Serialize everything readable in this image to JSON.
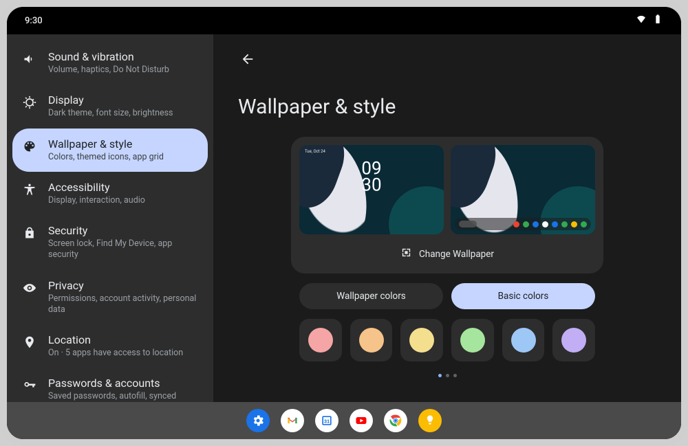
{
  "status": {
    "time": "9:30"
  },
  "sidebar": {
    "items": [
      {
        "title": "Sound & vibration",
        "sub": "Volume, haptics, Do Not Disturb"
      },
      {
        "title": "Display",
        "sub": "Dark theme, font size, brightness"
      },
      {
        "title": "Wallpaper & style",
        "sub": "Colors, themed icons, app grid",
        "selected": true
      },
      {
        "title": "Accessibility",
        "sub": "Display, interaction, audio"
      },
      {
        "title": "Security",
        "sub": "Screen lock, Find My Device, app security"
      },
      {
        "title": "Privacy",
        "sub": "Permissions, account activity, personal data"
      },
      {
        "title": "Location",
        "sub": "On · 5 apps have access to location"
      },
      {
        "title": "Passwords & accounts",
        "sub": "Saved passwords, autofill, synced"
      }
    ]
  },
  "page": {
    "title": "Wallpaper & style",
    "lock_clock_top": "09",
    "lock_clock_bottom": "30",
    "lock_date": "Tue, Oct 24",
    "change_label": "Change Wallpaper",
    "tabs": {
      "wallpaper": "Wallpaper colors",
      "basic": "Basic colors"
    },
    "basic_colors": [
      "#f5a5a5",
      "#f6c38a",
      "#f3df8e",
      "#a6e59d",
      "#9dc7f5",
      "#c2aef4"
    ],
    "home_icons": [
      "#ea4335",
      "#34a853",
      "#1a73e8",
      "#fff",
      "#1a73e8",
      "#34a853",
      "#fbbc04",
      "#34a853"
    ]
  },
  "taskbar": {
    "apps": [
      "settings",
      "gmail",
      "calendar",
      "youtube",
      "chrome",
      "keep"
    ]
  }
}
